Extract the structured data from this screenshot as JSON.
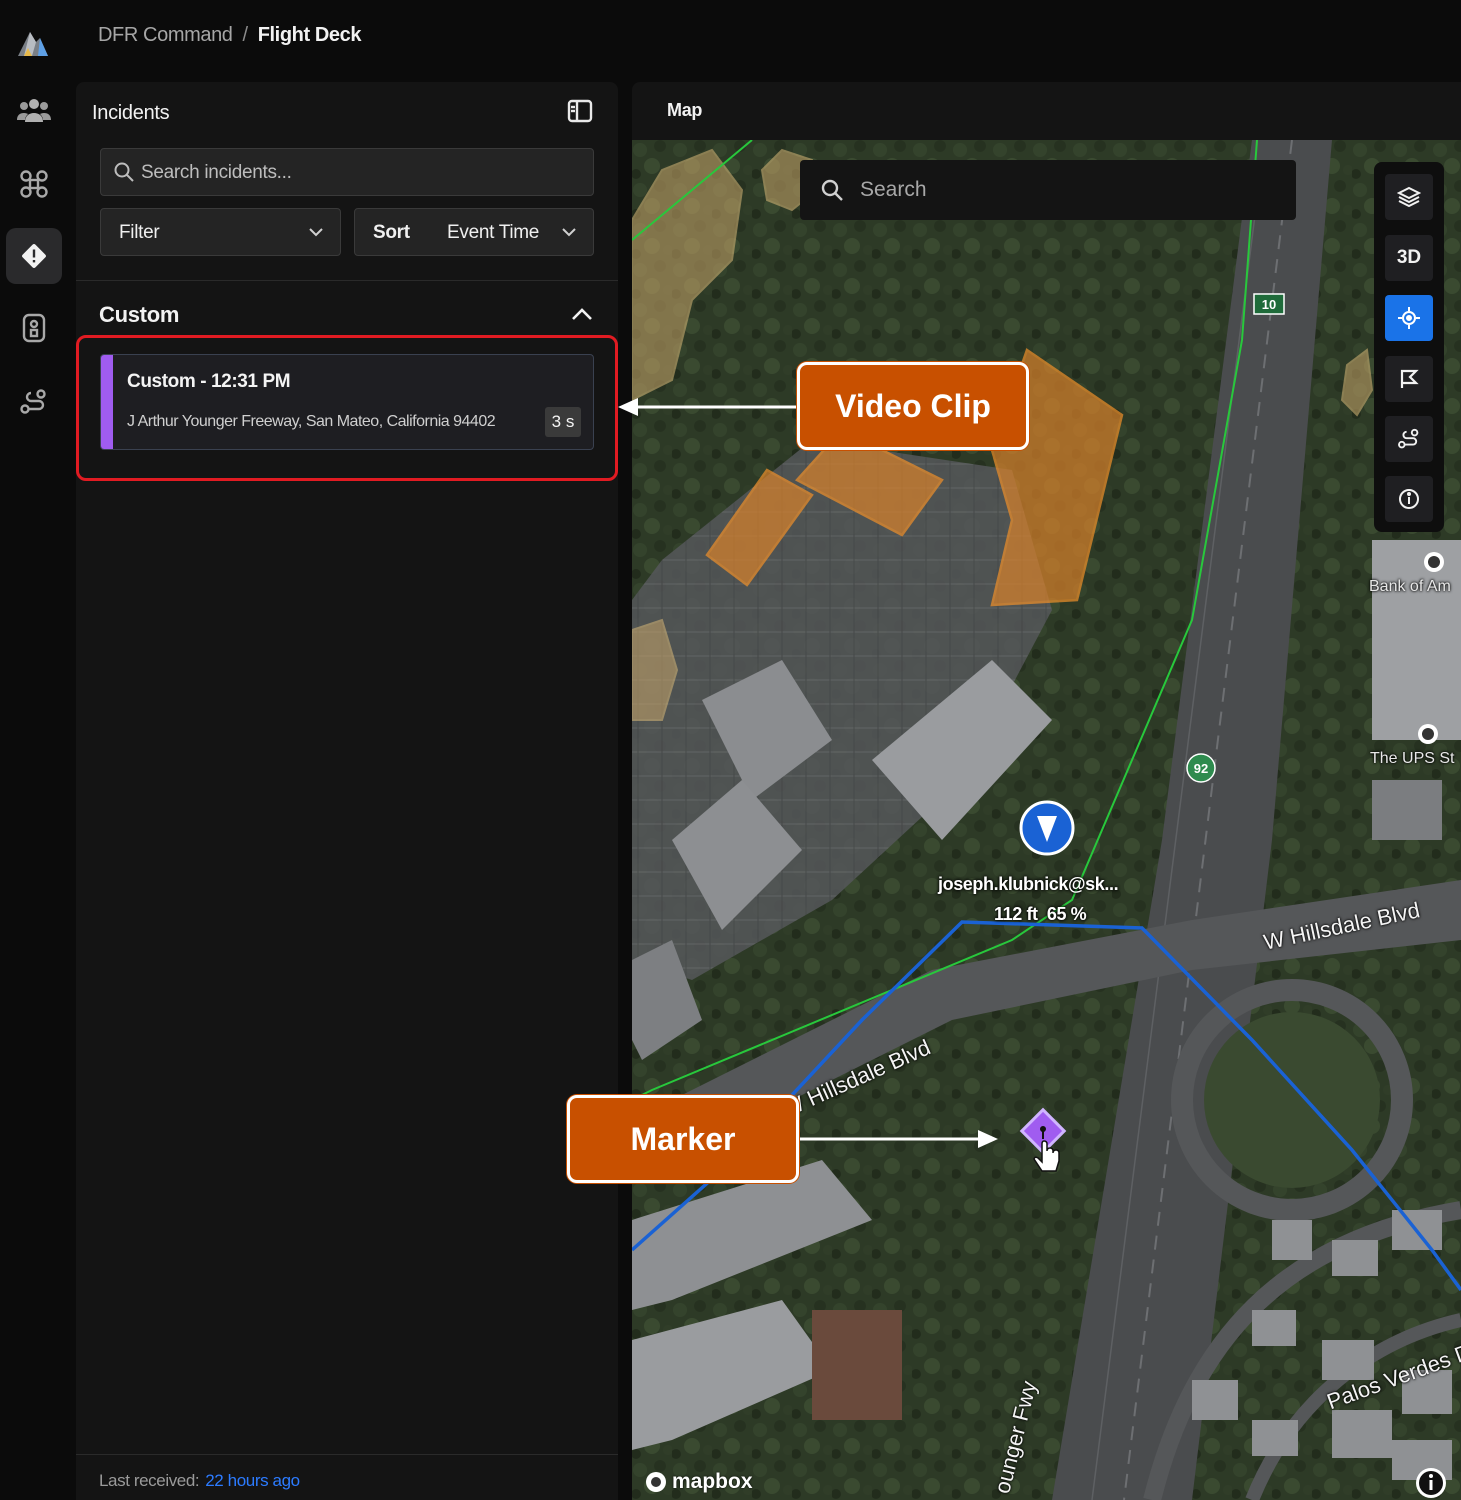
{
  "breadcrumb": {
    "root": "DFR Command",
    "separator": "/",
    "current": "Flight Deck"
  },
  "rail": {
    "items": [
      {
        "name": "team-icon",
        "active": false
      },
      {
        "name": "drone-icon",
        "active": false
      },
      {
        "name": "incidents-icon",
        "active": true
      },
      {
        "name": "dock-icon",
        "active": false
      },
      {
        "name": "route-icon",
        "active": false
      }
    ]
  },
  "incidents": {
    "title": "Incidents",
    "search_placeholder": "Search incidents...",
    "filter_label": "Filter",
    "sort_label": "Sort",
    "sort_value": "Event Time",
    "section": "Custom",
    "items": [
      {
        "title": "Custom - 12:31 PM",
        "address": "J Arthur Younger Freeway, San Mateo, California 94402",
        "duration": "3 s",
        "color": "#a05cf0"
      }
    ],
    "footer_label": "Last received:",
    "footer_value": "22 hours ago"
  },
  "map": {
    "title": "Map",
    "search_placeholder": "Search",
    "tools": [
      "layers-icon",
      "3D",
      "locate-icon",
      "flag-icon",
      "route-icon",
      "info-icon"
    ],
    "pois": [
      "Bank of Am",
      "The UPS St"
    ],
    "roads": [
      "W Hillsdale Blvd",
      "W Hillsdale Blvd",
      "Palos Verdes D",
      "ounger Fwy"
    ],
    "shields": [
      "10",
      "92"
    ],
    "drone": {
      "operator": "joseph.klubnick@sk...",
      "altitude": "112 ft",
      "battery": "65 %"
    },
    "attribution": "mapbox"
  },
  "callouts": {
    "video": "Video Clip",
    "marker": "Marker"
  },
  "colors": {
    "accent": "#1a73e8",
    "callout": "#c85000",
    "highlight": "#e11b22",
    "marker": "#a05cf0"
  }
}
